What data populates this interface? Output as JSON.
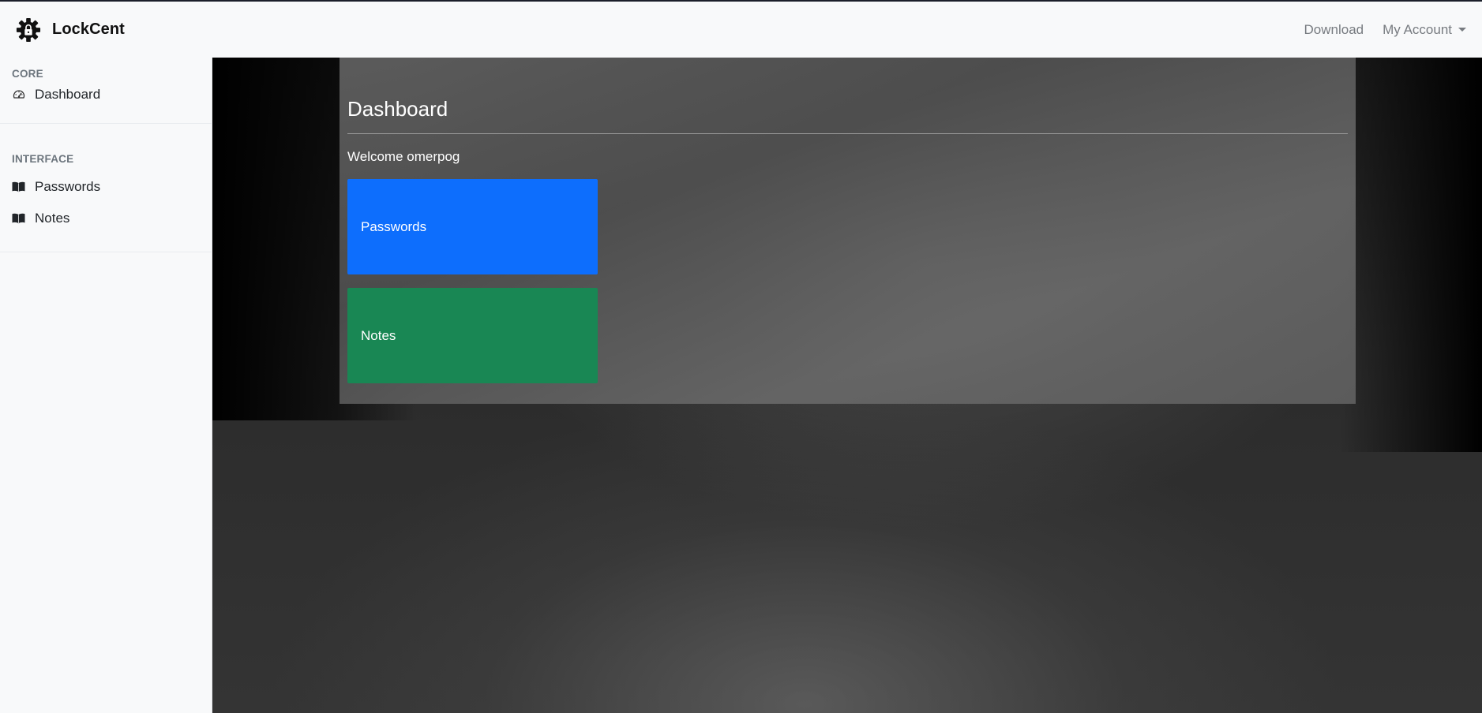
{
  "app": {
    "name": "LockCent"
  },
  "navbar": {
    "links": [
      {
        "label": "Download"
      },
      {
        "label": "My Account"
      }
    ]
  },
  "sidebar": {
    "sections": [
      {
        "heading": "Core",
        "items": [
          {
            "label": "Dashboard",
            "icon": "speedometer-icon"
          }
        ]
      },
      {
        "heading": "Interface",
        "items": [
          {
            "label": "Passwords",
            "icon": "book-icon"
          },
          {
            "label": "Notes",
            "icon": "book-icon"
          }
        ]
      }
    ]
  },
  "main": {
    "title": "Dashboard",
    "welcome": "Welcome omerpog",
    "tiles": [
      {
        "label": "Passwords",
        "color": "#0d6efd"
      },
      {
        "label": "Notes",
        "color": "#198754"
      }
    ]
  },
  "colors": {
    "primary": "#0d6efd",
    "success": "#198754",
    "sidebar_bg": "#f8f9fa"
  }
}
